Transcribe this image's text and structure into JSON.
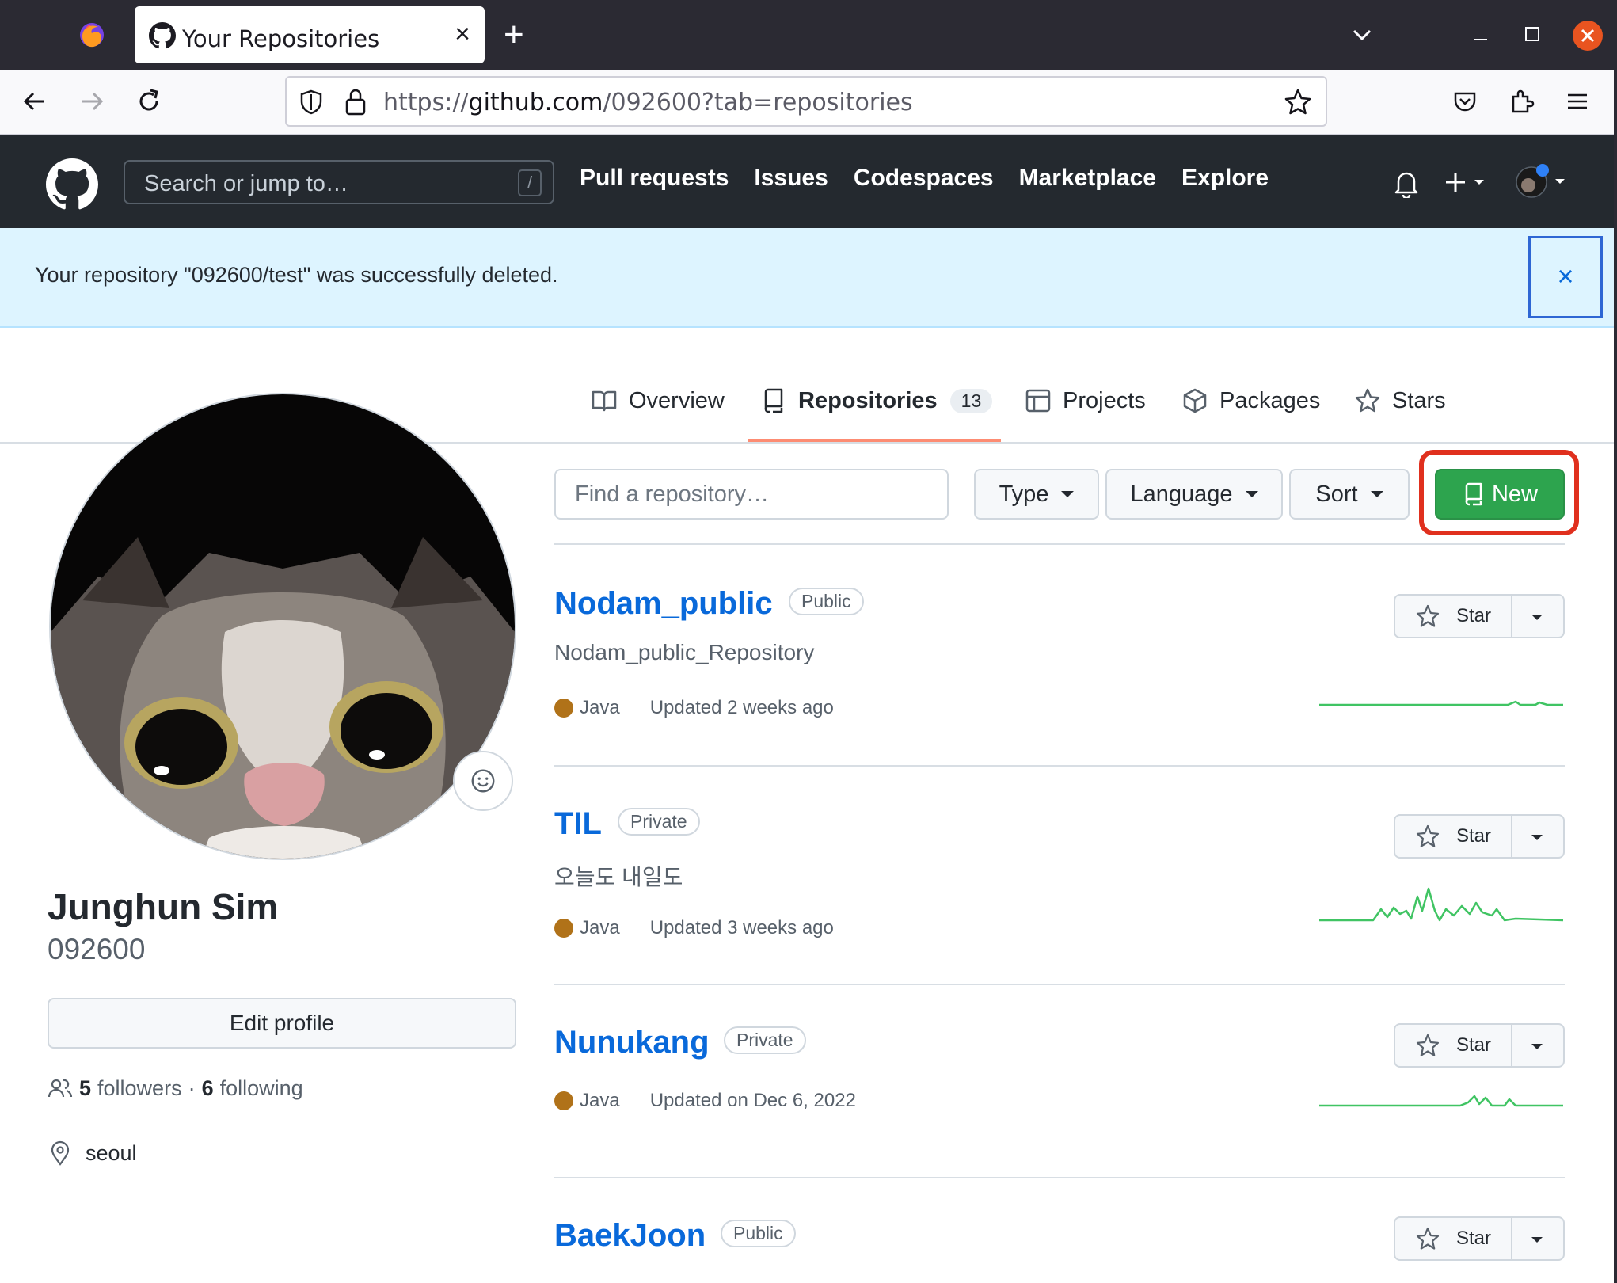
{
  "browser": {
    "tab_title": "Your Repositories",
    "tab_close": "×",
    "new_tab": "+",
    "url_prefix": "https://",
    "url_host": "github.com",
    "url_path": "/092600?tab=repositories"
  },
  "header": {
    "search_placeholder": "Search or jump to…",
    "search_shortcut": "/",
    "nav": [
      "Pull requests",
      "Issues",
      "Codespaces",
      "Marketplace",
      "Explore"
    ]
  },
  "flash": {
    "message": "Your repository \"092600/test\" was successfully deleted.",
    "close": "×"
  },
  "profile_tabs": {
    "overview": "Overview",
    "repositories": "Repositories",
    "repositories_count": "13",
    "projects": "Projects",
    "packages": "Packages",
    "stars": "Stars"
  },
  "profile": {
    "full_name": "Junghun Sim",
    "login": "092600",
    "edit_label": "Edit profile",
    "followers_count": "5",
    "followers_label": "followers",
    "separator": "·",
    "following_count": "6",
    "following_label": "following",
    "location": "seoul"
  },
  "filters": {
    "find_placeholder": "Find a repository…",
    "type": "Type",
    "language": "Language",
    "sort": "Sort",
    "new_label": "New"
  },
  "repos": [
    {
      "name": "Nodam_public",
      "visibility": "Public",
      "description": "Nodam_public_Repository",
      "language": "Java",
      "updated": "Updated 2 weeks ago",
      "star": "Star"
    },
    {
      "name": "TIL",
      "visibility": "Private",
      "description": "오늘도 내일도",
      "language": "Java",
      "updated": "Updated 3 weeks ago",
      "star": "Star"
    },
    {
      "name": "Nunukang",
      "visibility": "Private",
      "description": "",
      "language": "Java",
      "updated": "Updated on Dec 6, 2022",
      "star": "Star"
    },
    {
      "name": "BaekJoon",
      "visibility": "Public",
      "description": "",
      "language": "",
      "updated": "",
      "star": "Star"
    }
  ],
  "colors": {
    "accent_blue": "#0969da",
    "new_button": "#2da44e",
    "highlight_ring": "#e0301e",
    "java": "#b07219",
    "sparkline": "#40c463"
  }
}
